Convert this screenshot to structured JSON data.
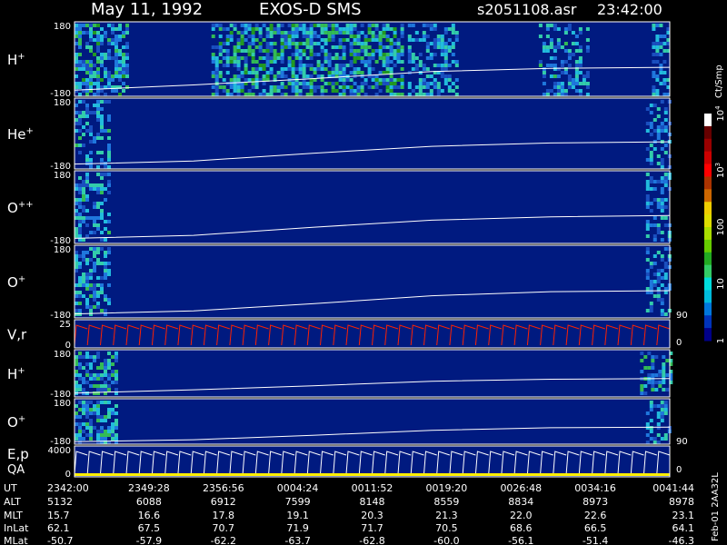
{
  "header": {
    "date": "May 11, 1992",
    "instrument": "EXOS-D SMS",
    "file": "s2051108.asr",
    "time": "23:42:00"
  },
  "colorbar": {
    "unit": "Ct/Smp",
    "ticks": [
      {
        "label": "1",
        "value": 1
      },
      {
        "label": "10",
        "value": 10
      },
      {
        "label": "100",
        "value": 100
      },
      {
        "label": "10",
        "sup": "3",
        "value": 1000
      },
      {
        "label": "10",
        "sup": "4",
        "value": 10000
      }
    ],
    "colors": [
      "#000088",
      "#0033bb",
      "#0077dd",
      "#00bbdd",
      "#00dddd",
      "#33cc66",
      "#22aa22",
      "#66cc00",
      "#aadd00",
      "#dddd00",
      "#eecc00",
      "#cc6600",
      "#aa3300",
      "#ff0000",
      "#cc0000",
      "#990000",
      "#660000",
      "#ffffff"
    ]
  },
  "chart_data": {
    "type": "heatmap",
    "panels": [
      {
        "label": "H",
        "sup": "+",
        "ytop": "180",
        "ybot": "-180",
        "blobs": [
          {
            "t0": 0.0,
            "t1": 0.09,
            "intensity": 0.55
          },
          {
            "t0": 0.23,
            "t1": 0.55,
            "intensity": 0.6
          },
          {
            "t0": 0.56,
            "t1": 0.64,
            "intensity": 0.35
          },
          {
            "t0": 0.78,
            "t1": 0.86,
            "intensity": 0.35
          },
          {
            "t0": 0.97,
            "t1": 1.0,
            "intensity": 0.3
          }
        ],
        "trace": [
          [
            0,
            -150
          ],
          [
            0.2,
            -125
          ],
          [
            0.4,
            -95
          ],
          [
            0.6,
            -60
          ],
          [
            0.8,
            -45
          ],
          [
            1,
            -40
          ]
        ]
      },
      {
        "label": "He",
        "sup": "+",
        "ytop": "180",
        "ybot": "-180",
        "blobs": [
          {
            "t0": 0.0,
            "t1": 0.06,
            "intensity": 0.35
          },
          {
            "t0": 0.96,
            "t1": 1.0,
            "intensity": 0.3
          }
        ],
        "trace": [
          [
            0,
            -155
          ],
          [
            0.2,
            -140
          ],
          [
            0.4,
            -100
          ],
          [
            0.6,
            -65
          ],
          [
            0.8,
            -48
          ],
          [
            1,
            -42
          ]
        ]
      },
      {
        "label": "O",
        "sup": "++",
        "ytop": "180",
        "ybot": "-180",
        "blobs": [
          {
            "t0": 0.0,
            "t1": 0.06,
            "intensity": 0.35
          },
          {
            "t0": 0.96,
            "t1": 1.0,
            "intensity": 0.3
          }
        ],
        "trace": [
          [
            0,
            -155
          ],
          [
            0.2,
            -140
          ],
          [
            0.4,
            -100
          ],
          [
            0.6,
            -65
          ],
          [
            0.8,
            -48
          ],
          [
            1,
            -42
          ]
        ]
      },
      {
        "label": "O",
        "sup": "+",
        "ytop": "180",
        "ybot": "-180",
        "blobs": [
          {
            "t0": 0.0,
            "t1": 0.06,
            "intensity": 0.4
          },
          {
            "t0": 0.96,
            "t1": 1.0,
            "intensity": 0.3
          }
        ],
        "trace": [
          [
            0,
            -160
          ],
          [
            0.2,
            -145
          ],
          [
            0.4,
            -110
          ],
          [
            0.6,
            -70
          ],
          [
            0.8,
            -50
          ],
          [
            1,
            -45
          ]
        ]
      },
      {
        "label": "V,r",
        "sup": "",
        "ytop": "25",
        "ybot": "0",
        "type": "sweep"
      },
      {
        "label": "H",
        "sup": "+",
        "ytop": "180",
        "ybot": "-180",
        "blobs": [
          {
            "t0": 0.0,
            "t1": 0.07,
            "intensity": 0.5
          },
          {
            "t0": 0.95,
            "t1": 1.0,
            "intensity": 0.45
          }
        ],
        "trace": [
          [
            0,
            -150
          ],
          [
            0.2,
            -125
          ],
          [
            0.4,
            -95
          ],
          [
            0.6,
            -60
          ],
          [
            0.8,
            -45
          ],
          [
            1,
            -40
          ]
        ]
      },
      {
        "label": "O",
        "sup": "+",
        "ytop": "180",
        "ybot": "-180",
        "blobs": [
          {
            "t0": 0.0,
            "t1": 0.07,
            "intensity": 0.5
          },
          {
            "t0": 0.96,
            "t1": 1.0,
            "intensity": 0.3
          }
        ],
        "trace": [
          [
            0,
            -160
          ],
          [
            0.2,
            -145
          ],
          [
            0.4,
            -110
          ],
          [
            0.6,
            -70
          ],
          [
            0.8,
            -50
          ],
          [
            1,
            -45
          ]
        ]
      },
      {
        "label": "E,p",
        "label2": "QA",
        "sup": "",
        "ytop": "4000",
        "ybot": "0",
        "type": "sweep"
      }
    ],
    "right_labels": [
      "90",
      "0",
      "90",
      "0"
    ],
    "ephemeris": {
      "rows": [
        {
          "name": "UT",
          "values": [
            "2342:00",
            "2349:28",
            "2356:56",
            "0004:24",
            "0011:52",
            "0019:20",
            "0026:48",
            "0034:16",
            "0041:44"
          ]
        },
        {
          "name": "ALT",
          "values": [
            "5132",
            "6088",
            "6912",
            "7599",
            "8148",
            "8559",
            "8834",
            "8973",
            "8978"
          ]
        },
        {
          "name": "MLT",
          "values": [
            "15.7",
            "16.6",
            "17.8",
            "19.1",
            "20.3",
            "21.3",
            "22.0",
            "22.6",
            "23.1"
          ]
        },
        {
          "name": "InLat",
          "values": [
            "62.1",
            "67.5",
            "70.7",
            "71.9",
            "71.7",
            "70.5",
            "68.6",
            "66.5",
            "64.1"
          ]
        },
        {
          "name": "MLat",
          "values": [
            "-50.7",
            "-57.9",
            "-62.2",
            "-63.7",
            "-62.8",
            "-60.0",
            "-56.1",
            "-51.4",
            "-46.3"
          ]
        }
      ]
    },
    "footer_note": "Feb-01 2AA32L"
  }
}
